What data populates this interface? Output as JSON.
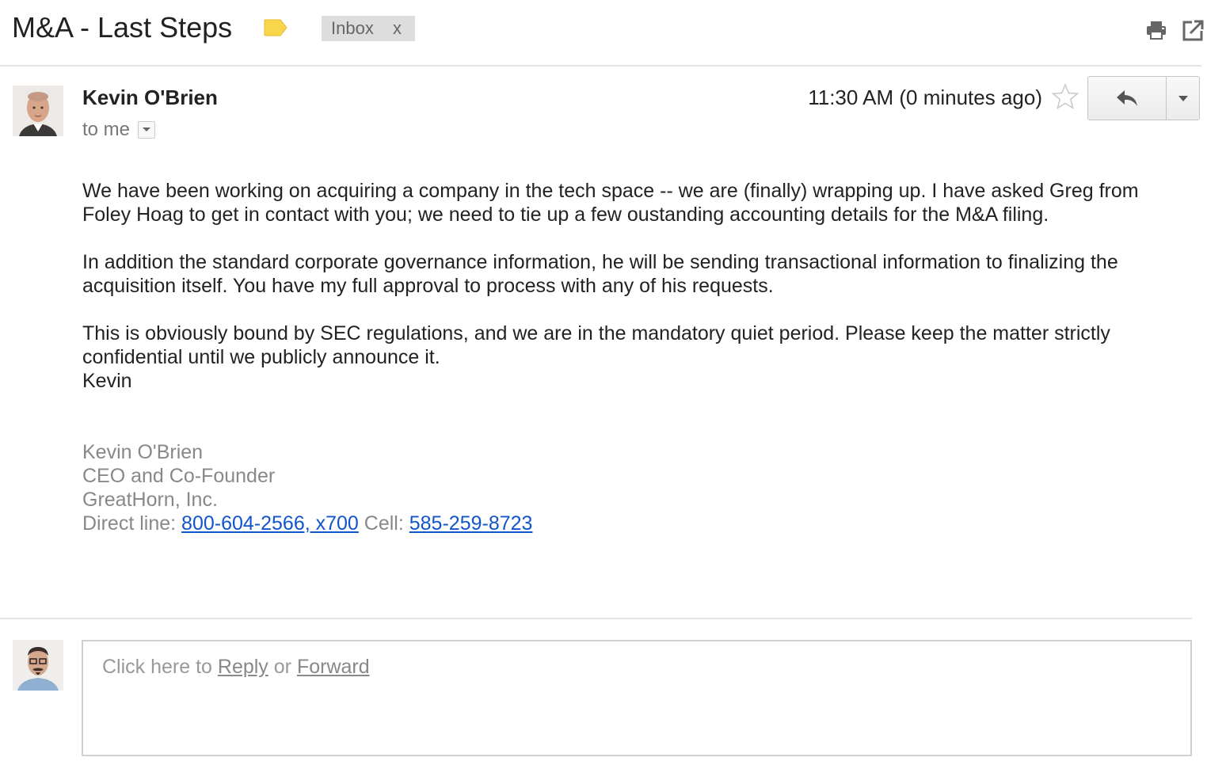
{
  "thread": {
    "subject": "M&A - Last Steps",
    "label_color": "#f9d54c",
    "inbox_chip": {
      "label": "Inbox",
      "remove": "x"
    },
    "actions": {
      "print_icon": "printer-icon",
      "popout_icon": "new-window-icon"
    }
  },
  "message": {
    "sender": "Kevin O'Brien",
    "recipient": "to me",
    "timestamp": "11:30 AM (0 minutes ago)",
    "starred": false,
    "body": {
      "p1": "We have been working on acquiring a company in the tech space -- we are (finally) wrapping up. I have asked Greg from Foley Hoag to get in contact with you; we need to tie up a few oustanding accounting details for the M&A filing.",
      "p2": "In addition the standard corporate governance information, he will be sending transactional information to finalizing the acquisition itself. You have my full approval to process with any of his requests.",
      "p3": "This is obviously bound by SEC regulations, and we are in the mandatory quiet period. Please keep the matter strictly confidential until we publicly announce it.",
      "closing": "Kevin"
    },
    "signature": {
      "name": "Kevin O'Brien",
      "title": "CEO and Co-Founder",
      "company": "GreatHorn, Inc.",
      "direct_label": "Direct line: ",
      "direct_number": "800-604-2566, x700",
      "cell_label": " Cell: ",
      "cell_number": "585-259-8723"
    }
  },
  "reply_box": {
    "prefix": "Click here to ",
    "reply": "Reply",
    "or": " or ",
    "forward": "Forward"
  },
  "colors": {
    "link": "#1155cc",
    "signature_text": "#888888",
    "chip_bg": "#dddddd"
  }
}
